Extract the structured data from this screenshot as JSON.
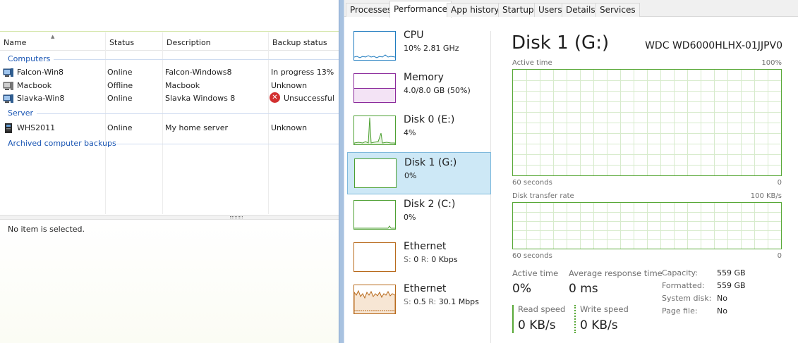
{
  "whs": {
    "columns": [
      "Name",
      "Status",
      "Description",
      "Backup status"
    ],
    "groups": {
      "computers": "Computers",
      "server": "Server",
      "archived": "Archived computer backups"
    },
    "computers": [
      {
        "name": "Falcon-Win8",
        "status": "Online",
        "description": "Falcon-Windows8",
        "backup": "In progress 13%"
      },
      {
        "name": "Macbook",
        "status": "Offline",
        "description": "Macbook",
        "backup": "Unknown"
      },
      {
        "name": "Slavka-Win8",
        "status": "Online",
        "description": "Slavka Windows 8",
        "backup": "Unsuccessful"
      }
    ],
    "servers": [
      {
        "name": "WHS2011",
        "status": "Online",
        "description": "My home server",
        "backup": "Unknown"
      }
    ],
    "details_message": "No item is selected."
  },
  "taskmanager": {
    "tabs": [
      "Processes",
      "Performance",
      "App history",
      "Startup",
      "Users",
      "Details",
      "Services"
    ],
    "active_tab": "Performance",
    "items": [
      {
        "title": "CPU",
        "value": "10% 2.81 GHz",
        "color": "#1e7bbf"
      },
      {
        "title": "Memory",
        "value": "4.0/8.0 GB (50%)",
        "color": "#8b2a9b"
      },
      {
        "title": "Disk 0 (E:)",
        "value": "4%",
        "color": "#4da032"
      },
      {
        "title": "Disk 1 (G:)",
        "value": "0%",
        "color": "#4da032"
      },
      {
        "title": "Disk 2 (C:)",
        "value": "0%",
        "color": "#4da032"
      },
      {
        "title": "Ethernet",
        "value_s_label": "S:",
        "value_s": "0",
        "value_r_label": "R:",
        "value_r": "0 Kbps",
        "color": "#b86a1c"
      },
      {
        "title": "Ethernet",
        "value_s_label": "S:",
        "value_s": "0.5",
        "value_r_label": "R:",
        "value_r": "30.1 Mbps",
        "color": "#b86a1c"
      }
    ],
    "selected_index": 3,
    "detail": {
      "title": "Disk 1 (G:)",
      "model": "WDC WD6000HLHX-01JJPV0",
      "active_time_label": "Active time",
      "active_time_max": "100%",
      "seconds_label": "60 seconds",
      "zero_label": "0",
      "transfer_label": "Disk transfer rate",
      "transfer_max": "100 KB/s",
      "stats": {
        "active_time_label": "Active time",
        "active_time_value": "0%",
        "avg_resp_label": "Average response time",
        "avg_resp_value": "0 ms",
        "read_label": "Read speed",
        "read_value": "0 KB/s",
        "write_label": "Write speed",
        "write_value": "0 KB/s"
      },
      "props": [
        {
          "key": "Capacity:",
          "value": "559 GB"
        },
        {
          "key": "Formatted:",
          "value": "559 GB"
        },
        {
          "key": "System disk:",
          "value": "No"
        },
        {
          "key": "Page file:",
          "value": "No"
        }
      ],
      "graph_color": "#58a837"
    }
  }
}
